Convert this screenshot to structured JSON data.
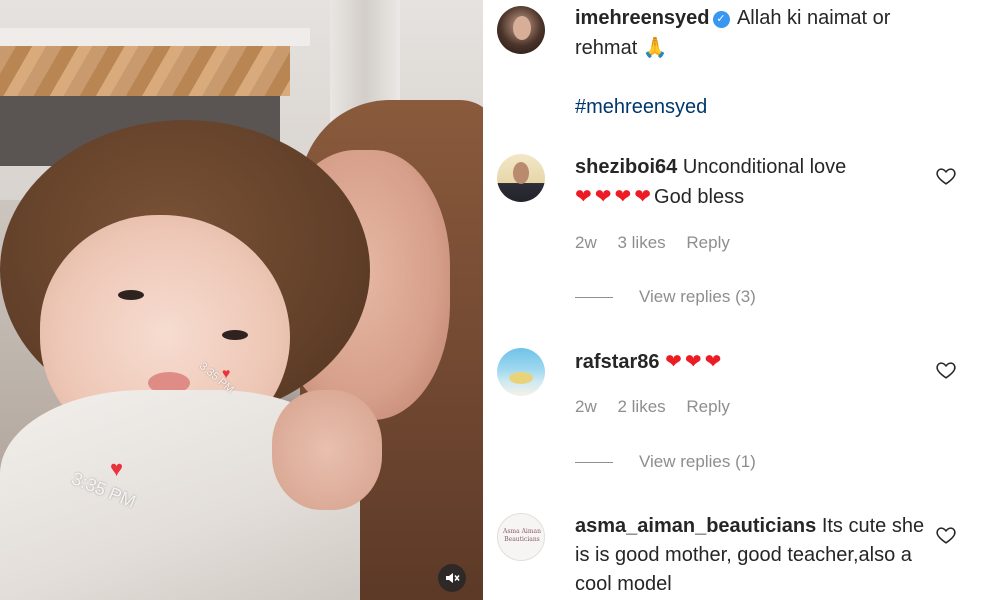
{
  "photo": {
    "sticker_time_big": "3:35 PM",
    "sticker_time_small": "3:35 PM",
    "sticker_icon": "heart",
    "mute_icon": "speaker-muted-icon"
  },
  "caption": {
    "username": "imehreensyed",
    "verified": true,
    "text": "Allah ki naimat or rehmat",
    "emoji": "🙏",
    "hashtag": "#mehreensyed"
  },
  "comments": [
    {
      "username": "sheziboi64",
      "text_line1": "Unconditional love",
      "hearts": "❤❤❤❤",
      "text_line2": "God bless",
      "time": "2w",
      "likes": "3 likes",
      "reply_label": "Reply",
      "view_replies": "View replies (3)"
    },
    {
      "username": "rafstar86",
      "hearts": "❤❤❤",
      "time": "2w",
      "likes": "2 likes",
      "reply_label": "Reply",
      "view_replies": "View replies (1)"
    },
    {
      "username": "asma_aiman_beauticians",
      "text": "Its cute she is is good mother, good teacher,also a cool model",
      "avatar_text": "Asma Aiman Beauticians"
    }
  ],
  "colors": {
    "text": "#262626",
    "secondary": "#8e8e8e",
    "link": "#00376b",
    "verified": "#3897f0",
    "heart": "#ed1c24"
  }
}
